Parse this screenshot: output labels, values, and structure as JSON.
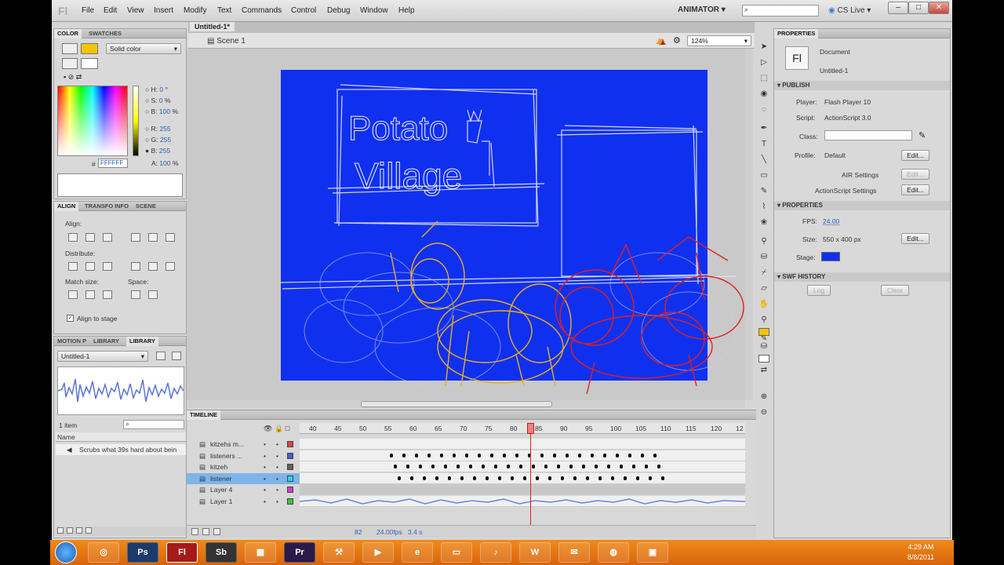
{
  "menu": {
    "logo": "Fl",
    "items": [
      "File",
      "Edit",
      "View",
      "Insert",
      "Modify",
      "Text",
      "Commands",
      "Control",
      "Debug",
      "Window",
      "Help"
    ],
    "workspace": "ANIMATOR",
    "cs_live": "CS Live"
  },
  "color_panel": {
    "tabs": [
      "COLOR",
      "SWATCHES"
    ],
    "type": "Solid color",
    "fields": [
      {
        "label": "H:",
        "value": "0",
        "unit": "°"
      },
      {
        "label": "S:",
        "value": "0",
        "unit": "%"
      },
      {
        "label": "B:",
        "value": "100",
        "unit": "%"
      },
      {
        "label": "R:",
        "value": "255",
        "unit": ""
      },
      {
        "label": "G:",
        "value": "255",
        "unit": ""
      },
      {
        "label": "B:",
        "value": "255",
        "unit": ""
      },
      {
        "label": "A:",
        "value": "100",
        "unit": "%"
      }
    ],
    "hex_prefix": "#",
    "hex": "FFFFFF"
  },
  "align_panel": {
    "tabs": [
      "ALIGN",
      "TRANSFO",
      "INFO",
      "SCENE"
    ],
    "align_label": "Align:",
    "distribute_label": "Distribute:",
    "match_label": "Match size:",
    "space_label": "Space:",
    "align_to_stage": "Align to stage"
  },
  "library_panel": {
    "tabs": [
      "MOTION P",
      "LIBRARY",
      "LIBRARY"
    ],
    "doc": "Untitled-1",
    "count": "1 item",
    "name_header": "Name",
    "item": "Scrubs what 39s hard about bein"
  },
  "document": {
    "tab": "Untitled-1*",
    "scene": "Scene 1",
    "zoom": "124%"
  },
  "properties": {
    "title": "PROPERTIES",
    "doc_type": "Document",
    "doc_name": "Untitled-1",
    "publish_header": "PUBLISH",
    "player_label": "Player:",
    "player": "Flash Player 10",
    "script_label": "Script:",
    "script": "ActionScript 3.0",
    "class_label": "Class:",
    "profile_label": "Profile:",
    "profile": "Default",
    "edit": "Edit...",
    "air_settings": "AIR Settings",
    "as_settings": "ActionScript Settings",
    "props_header": "PROPERTIES",
    "fps_label": "FPS:",
    "fps": "24.00",
    "size_label": "Size:",
    "size": "550 x 400 px",
    "stage_label": "Stage:",
    "stage_color": "#1030f0",
    "swf_header": "SWF HISTORY",
    "log": "Log",
    "clear": "Clear"
  },
  "timeline": {
    "title": "TIMELINE",
    "ticks": [
      "40",
      "45",
      "50",
      "55",
      "60",
      "65",
      "70",
      "75",
      "80",
      "85",
      "90",
      "95",
      "100",
      "105",
      "110",
      "115",
      "120",
      "12"
    ],
    "layers": [
      {
        "name": "kitzehs m...",
        "color": "#e04040"
      },
      {
        "name": "listeners ...",
        "color": "#4060d0"
      },
      {
        "name": "kitzeh",
        "color": "#606060"
      },
      {
        "name": "listener",
        "color": "#30d0e0"
      },
      {
        "name": "Layer 4",
        "color": "#d040c0"
      },
      {
        "name": "Layer 1",
        "color": "#40c040"
      }
    ],
    "current_frame": "82",
    "fps": "24.00",
    "fps_unit": "fps",
    "time": "3.4 s"
  },
  "stage_art": {
    "title_line1": "Potato",
    "title_line2": "Village"
  },
  "clock": {
    "time": "4:29 AM",
    "date": "8/8/2011"
  },
  "taskbar": [
    "Ps",
    "Fl",
    "Sb",
    "Pr"
  ]
}
